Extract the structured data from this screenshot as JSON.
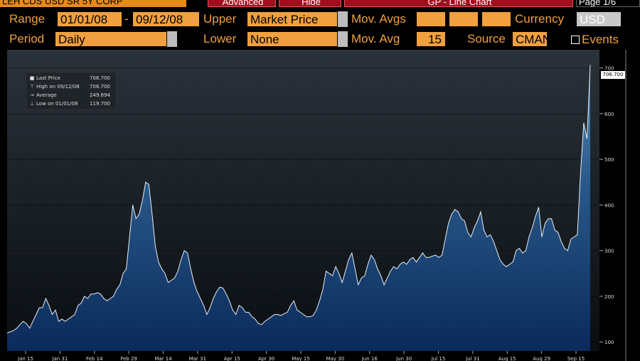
{
  "topbar": {
    "security": "LEH CDS USD SR 5Y CORP",
    "advanced": "Advanced",
    "hide": "Hide",
    "chart_title": "GP - Line Chart",
    "page": "Page 1/6"
  },
  "controls": {
    "range_label": "Range",
    "range_start": "01/01/08",
    "range_dash": "-",
    "range_end": "09/12/08",
    "upper_label": "Upper",
    "upper_value": "Market Price",
    "mov_avgs_label": "Mov. Avgs",
    "currency_label": "Currency",
    "currency_value": "USD",
    "period_label": "Period",
    "period_value": "Daily",
    "lower_label": "Lower",
    "lower_value": "None",
    "mov_avg_label": "Mov. Avg",
    "mov_avg_value": "15",
    "source_label": "Source",
    "source_value": "CMAN",
    "events_label": "Events"
  },
  "legend": {
    "last_price_label": "Last Price",
    "last_price_value": "706.700",
    "high_label": "High on 09/12/08",
    "high_value": "706.700",
    "average_label": "Average",
    "average_value": "249.694",
    "low_label": "Low on 01/01/08",
    "low_value": "119.700"
  },
  "last_tag": "706.700",
  "colors": {
    "accent": "#f0a040",
    "field": "#f0a040",
    "red_button": "#a00f1e"
  },
  "chart_data": {
    "type": "area",
    "x_tick_labels": [
      "Jan 15",
      "Jan 31",
      "Feb 14",
      "Feb 29",
      "Mar 14",
      "Mar 31",
      "Apr 15",
      "Apr 30",
      "May 15",
      "May 30",
      "Jun 16",
      "Jun 30",
      "Jul 15",
      "Jul 31",
      "Aug 15",
      "Aug 29",
      "Sep 15"
    ],
    "y_ticks": [
      100,
      200,
      300,
      400,
      500,
      600,
      700
    ],
    "ylim": [
      80,
      740
    ],
    "values": [
      119.7,
      122,
      125,
      130,
      138,
      145,
      140,
      130,
      145,
      160,
      175,
      175,
      195,
      180,
      160,
      170,
      145,
      150,
      145,
      150,
      155,
      160,
      180,
      185,
      200,
      195,
      205,
      205,
      208,
      205,
      195,
      190,
      195,
      200,
      215,
      225,
      250,
      260,
      330,
      400,
      370,
      380,
      410,
      450,
      445,
      380,
      310,
      275,
      260,
      250,
      230,
      235,
      240,
      255,
      280,
      300,
      295,
      260,
      230,
      210,
      195,
      180,
      160,
      175,
      195,
      210,
      220,
      218,
      205,
      190,
      170,
      160,
      180,
      175,
      165,
      165,
      155,
      150,
      140,
      138,
      145,
      150,
      155,
      160,
      160,
      158,
      162,
      165,
      180,
      190,
      170,
      165,
      160,
      155,
      155,
      158,
      170,
      190,
      215,
      255,
      250,
      245,
      265,
      250,
      230,
      255,
      280,
      295,
      260,
      225,
      240,
      245,
      270,
      290,
      280,
      260,
      245,
      225,
      240,
      255,
      265,
      260,
      270,
      275,
      270,
      280,
      285,
      275,
      285,
      295,
      285,
      285,
      288,
      290,
      285,
      290,
      325,
      360,
      380,
      390,
      385,
      370,
      365,
      340,
      330,
      350,
      365,
      385,
      345,
      330,
      335,
      320,
      300,
      280,
      270,
      265,
      270,
      275,
      300,
      305,
      295,
      300,
      330,
      350,
      375,
      395,
      330,
      360,
      370,
      370,
      345,
      340,
      320,
      305,
      300,
      325,
      330,
      335,
      470,
      580,
      545,
      706.7
    ]
  }
}
